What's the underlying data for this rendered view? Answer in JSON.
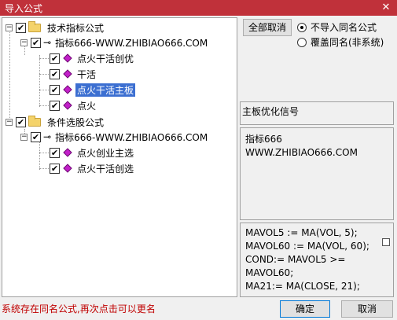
{
  "window": {
    "title": "导入公式",
    "close": "✕"
  },
  "tree": {
    "group1": {
      "label": "技术指标公式",
      "formula": {
        "label": "指标666-WWW.ZHIBIAO666.COM",
        "items": [
          "点火干活创优",
          "干活",
          "点火干活主板",
          "点火"
        ]
      }
    },
    "group2": {
      "label": "条件选股公式",
      "formula": {
        "label": "指标666-WWW.ZHIBIAO666.COM",
        "items": [
          "点火创业主选",
          "点火干活创选"
        ]
      }
    },
    "selected": "点火干活主板"
  },
  "options": {
    "cancel_all": "全部取消",
    "radio1": "不导入同名公式",
    "radio2": "覆盖同名(非系统)",
    "selected_radio": "radio1"
  },
  "description": {
    "title": "主板优化信号"
  },
  "info": {
    "line1": "指标666",
    "line2": "WWW.ZHIBIAO666.COM"
  },
  "code": {
    "lines": [
      "MAVOL5 := MA(VOL, 5);",
      "MAVOL60 := MA(VOL, 60);",
      "COND:= MAVOL5 >=",
      "MAVOL60;",
      "MA21:= MA(CLOSE, 21);"
    ]
  },
  "status": "系统存在同名公式,再次点击可以更名",
  "buttons": {
    "ok": "确定",
    "cancel": "取消"
  }
}
